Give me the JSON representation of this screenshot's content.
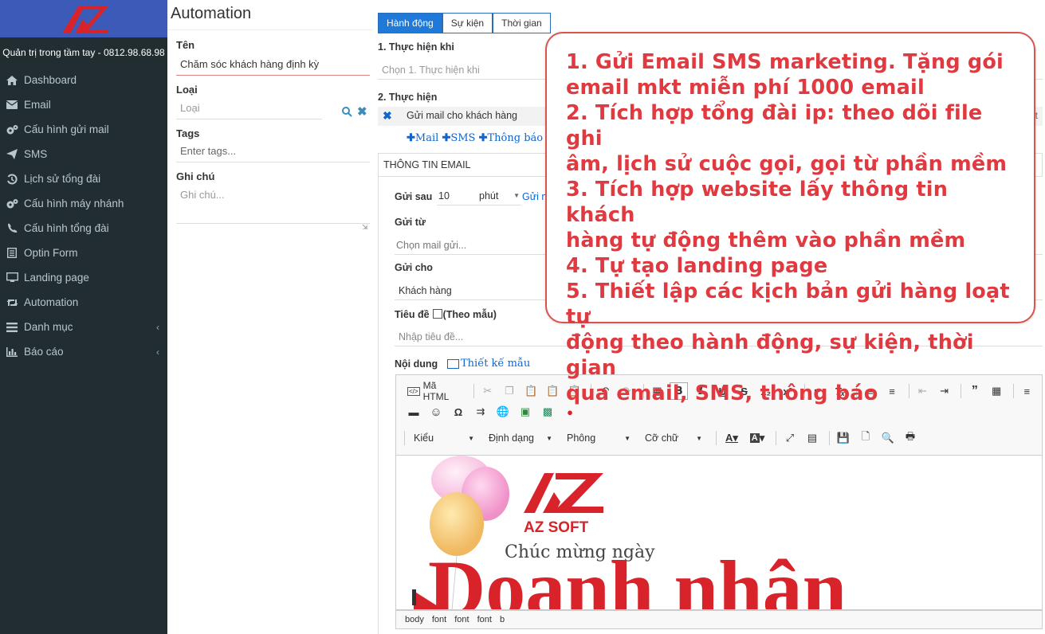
{
  "sidebar": {
    "hotline": "Quản trị trong tầm tay - 0812.98.68.98",
    "items": [
      {
        "label": "Dashboard",
        "icon": "home-icon"
      },
      {
        "label": "Email",
        "icon": "envelope-icon"
      },
      {
        "label": "Cấu hình gửi mail",
        "icon": "cogs-icon"
      },
      {
        "label": "SMS",
        "icon": "paper-plane-icon"
      },
      {
        "label": "Lịch sử tổng đài",
        "icon": "history-icon"
      },
      {
        "label": "Cấu hình máy nhánh",
        "icon": "cogs-icon"
      },
      {
        "label": "Cấu hình tổng đài",
        "icon": "phone-icon"
      },
      {
        "label": "Optin Form",
        "icon": "form-icon"
      },
      {
        "label": "Landing page",
        "icon": "monitor-icon"
      },
      {
        "label": "Automation",
        "icon": "retweet-icon"
      },
      {
        "label": "Danh mục",
        "icon": "list-icon"
      },
      {
        "label": "Báo cáo",
        "icon": "bar-chart-icon"
      }
    ]
  },
  "form": {
    "title": "Automation",
    "name_label": "Tên",
    "name_value": "Chăm sóc khách hàng định kỳ",
    "type_label": "Loại",
    "type_placeholder": "Loại",
    "tags_label": "Tags",
    "tags_placeholder": "Enter tags...",
    "note_label": "Ghi chú",
    "note_placeholder": "Ghi chú..."
  },
  "tabs": [
    "Hành động",
    "Sự kiện",
    "Thời gian"
  ],
  "trigger": {
    "label": "1. Thực hiện khi",
    "placeholder": "Chọn 1. Thực hiện khi"
  },
  "action": {
    "label": "2. Thực hiện",
    "item": "Gửi mail cho khách hàng",
    "trailing": "it",
    "add_mail": "Mail",
    "add_sms": "SMS",
    "add_notify": "Thông báo"
  },
  "email": {
    "section_title": "THÔNG TIN EMAIL",
    "send_after_label": "Gửi sau",
    "send_after_value": "10",
    "unit": "phút",
    "unit_suffix": "Gửi n",
    "from_label": "Gửi từ",
    "from_placeholder": "Chọn mail gửi...",
    "to_label": "Gửi cho",
    "to_value": "Khách hàng",
    "subject_label": "Tiêu đề",
    "template_label": "(Theo mẫu)",
    "subject_placeholder": "Nhập tiêu đề...",
    "content_label": "Nội dung",
    "design_link": "Thiết kế mẫu"
  },
  "editor": {
    "source_label": "Mã HTML",
    "combos": [
      "Kiểu",
      "Định dạng",
      "Phông",
      "Cỡ chữ"
    ],
    "banner_logo": "AZ SOFT",
    "banner_greeting": "Chúc mừng ngày",
    "banner_big": "Doanh nhân",
    "path": [
      "body",
      "font",
      "font",
      "font",
      "b"
    ]
  },
  "callout": {
    "lines": [
      "1. Gửi Email SMS marketing. Tặng gói",
      "email mkt miễn phí 1000 email",
      "2. Tích hợp tổng đài ip: theo dõi file ghi",
      "âm, lịch sử cuộc gọi, gọi từ phần mềm",
      "3. Tích hợp website lấy thông tin khách",
      "hàng tự động thêm vào phần mềm",
      "4. Tự tạo landing page",
      "5. Thiết lập các kịch bản gửi hàng loạt tự",
      "động theo hành động, sự kiện, thời gian",
      "qua email, SMS, thông báo"
    ]
  },
  "colors": {
    "sidebar_bg": "#222d32",
    "brand_bg": "#3c5bb8",
    "accent": "#1e79d8",
    "callout_red": "#e0393f",
    "logo_red": "#d8232a"
  }
}
